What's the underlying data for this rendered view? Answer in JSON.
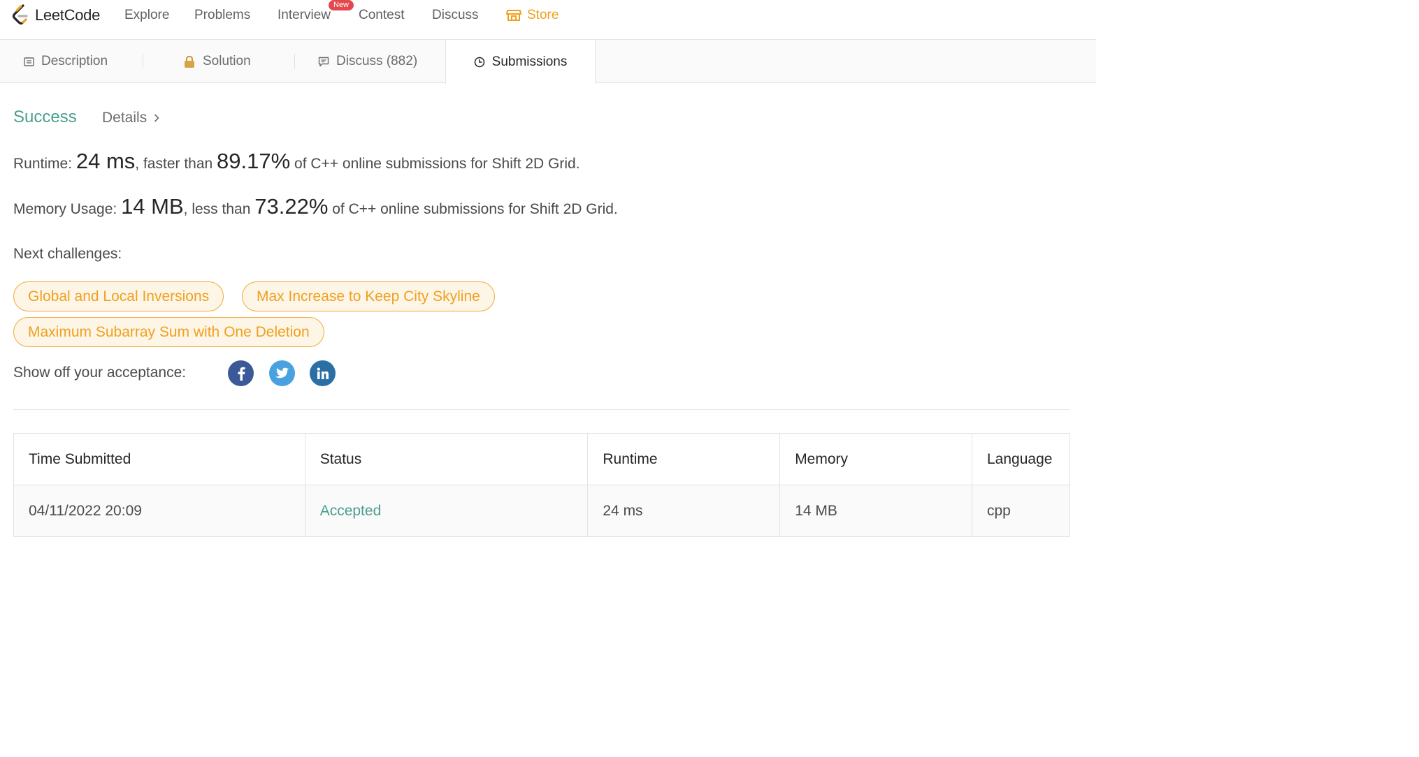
{
  "nav": {
    "brand": "LeetCode",
    "items": [
      "Explore",
      "Problems",
      "Interview",
      "Contest",
      "Discuss"
    ],
    "badge": "New",
    "store": "Store"
  },
  "tabs": {
    "description": "Description",
    "solution": "Solution",
    "discuss": "Discuss (882)",
    "submissions": "Submissions"
  },
  "result": {
    "status": "Success",
    "details": "Details",
    "runtime_label": "Runtime:",
    "runtime_value": "24 ms",
    "runtime_mid": ", faster than",
    "runtime_pct": "89.17%",
    "runtime_tail": "of C++ online submissions for Shift 2D Grid.",
    "memory_label": "Memory Usage:",
    "memory_value": "14 MB",
    "memory_mid": ", less than",
    "memory_pct": "73.22%",
    "memory_tail": "of C++ online submissions for Shift 2D Grid."
  },
  "next": {
    "label": "Next challenges:",
    "challenges": [
      "Global and Local Inversions",
      "Max Increase to Keep City Skyline",
      "Maximum Subarray Sum with One Deletion"
    ]
  },
  "share": {
    "label": "Show off your acceptance:",
    "icons": [
      "facebook-icon",
      "twitter-icon",
      "linkedin-icon"
    ]
  },
  "table": {
    "headers": [
      "Time Submitted",
      "Status",
      "Runtime",
      "Memory",
      "Language"
    ],
    "rows": [
      [
        "04/11/2022 20:09",
        "Accepted",
        "24 ms",
        "14 MB",
        "cpp"
      ]
    ]
  },
  "colors": {
    "accent": "#f0a020",
    "success": "#4a9e8e",
    "badge": "#e5474f",
    "facebook": "#3b5998",
    "twitter": "#4aa1e0",
    "linkedin": "#2b6fa4"
  }
}
